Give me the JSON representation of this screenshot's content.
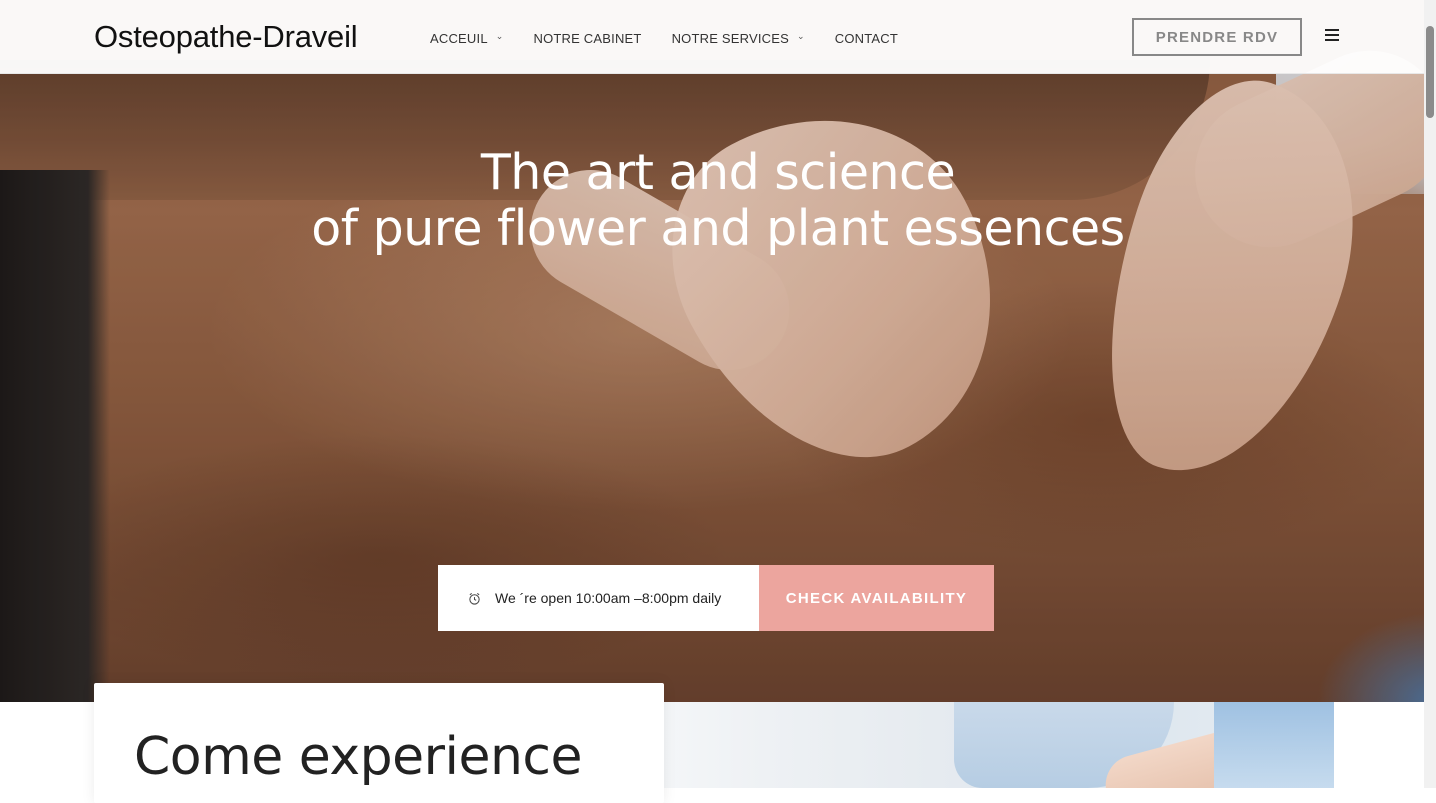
{
  "header": {
    "logo": "Osteopathe-Draveil",
    "nav": [
      {
        "label": "ACCEUIL",
        "has_dropdown": true
      },
      {
        "label": "NOTRE CABINET",
        "has_dropdown": false
      },
      {
        "label": "NOTRE SERVICES",
        "has_dropdown": true
      },
      {
        "label": "CONTACT",
        "has_dropdown": false
      }
    ],
    "cta_label": "PRENDRE RDV",
    "menu_icon": "hamburger-icon"
  },
  "hero": {
    "title_line1": "The art and science",
    "title_line2": "of pure flower and plant essences",
    "hours_text": "We ´re open 10:00am –8:00pm daily",
    "hours_icon": "alarm-clock-icon",
    "check_label": "CHECK AVAILABILITY",
    "accent_color": "#eca59e"
  },
  "intro": {
    "heading": "Come experience"
  }
}
